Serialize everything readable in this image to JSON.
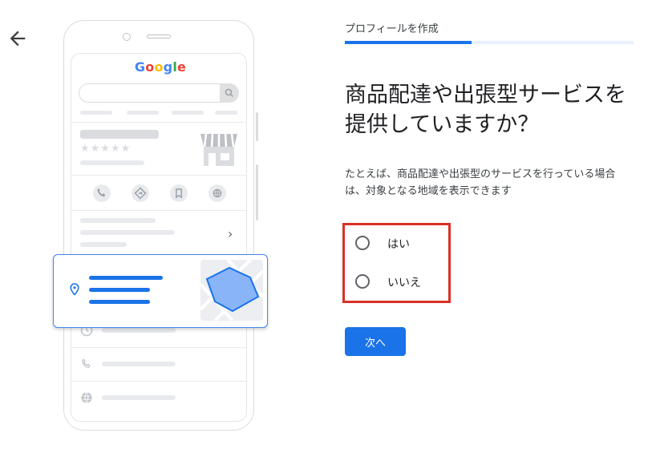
{
  "header": {
    "back_icon": "arrow-left-icon",
    "breadcrumb": "プロフィールを作成",
    "progress": 0.44
  },
  "illustration": {
    "logo_text": "Google",
    "logo_letters": [
      {
        "ch": "G",
        "color": "#4285f4"
      },
      {
        "ch": "o",
        "color": "#ea4335"
      },
      {
        "ch": "o",
        "color": "#fbbc05"
      },
      {
        "ch": "g",
        "color": "#4285f4"
      },
      {
        "ch": "l",
        "color": "#34a853"
      },
      {
        "ch": "e",
        "color": "#ea4335"
      }
    ],
    "stars": "★★★★★",
    "chevron": "›",
    "icons": [
      "search-icon",
      "phone-icon",
      "directions-icon",
      "bookmark-icon",
      "globe-icon",
      "map-pin-icon",
      "clock-icon",
      "store-icon",
      "map-icon"
    ]
  },
  "main": {
    "question": "商品配達や出張型サービスを提供していますか？",
    "description": "たとえば、商品配達や出張型のサービスを行っている場合は、対象となる地域を表示できます",
    "options": [
      {
        "label": "はい",
        "selected": false
      },
      {
        "label": "いいえ",
        "selected": false
      }
    ],
    "next_label": "次へ"
  },
  "colors": {
    "accent": "#1a73e8",
    "highlight_border": "#d93025",
    "progress_track": "#e8f0fe"
  }
}
